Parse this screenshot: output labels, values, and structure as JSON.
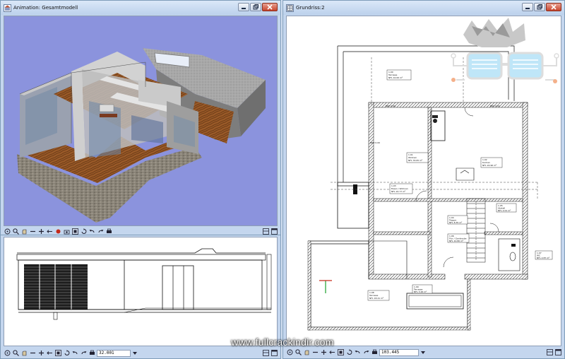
{
  "windows": {
    "animation": {
      "title": "Animation: Gesamtmodell"
    },
    "elevation": {
      "scale": "32.001"
    },
    "grundriss": {
      "title": "Grundriss:2",
      "scale": "103.445"
    }
  },
  "plan_labels": {
    "room_top": [
      "1.00",
      "Terrasse",
      "NFL 10.00 m²"
    ],
    "dim_top_left": "BRH 0.00",
    "dim_top_right": "BRH 0.00",
    "dim_left": "BRH 0.00",
    "room_wohnen": [
      "1.01",
      "Wohnen",
      "NFL 33.65 m²"
    ],
    "room_kochen": [
      "1.02",
      "Kochen",
      "NFL 24.96 m²"
    ],
    "room_essen": [
      "1.03",
      "Essen / Wohnen",
      "NFL 22.77 m²"
    ],
    "room_flur": [
      "1.04",
      "Treppe",
      "NFL 8.35 m²"
    ],
    "room_bad": [
      "1.05",
      "Abstell",
      "NFL 2.01 m²"
    ],
    "room_gast": [
      "1.06",
      "Flur / Garderobe",
      "NFL 10.80 m²"
    ],
    "room_wc": [
      "1.07",
      "WC",
      "NFL 2.87 m²"
    ],
    "room_terr2": [
      "1.08",
      "Terrasse",
      "NFL 18.41 m²"
    ],
    "room_bottom": [
      "1.09",
      "Terrasse",
      "NFL 3.26 m²"
    ]
  },
  "watermark": "www.fullcrackindir.com",
  "icons": [
    "app-icon",
    "minimize-icon",
    "restore-icon",
    "close-icon",
    "zoom-icon",
    "pan-icon",
    "rotate-icon",
    "undo-icon",
    "redo-icon",
    "print-icon"
  ],
  "colors": {
    "sky": "#8b93dd",
    "frame": "#c4d6ee",
    "wood": "#9a5a28",
    "concrete": "#9a9a9a"
  }
}
